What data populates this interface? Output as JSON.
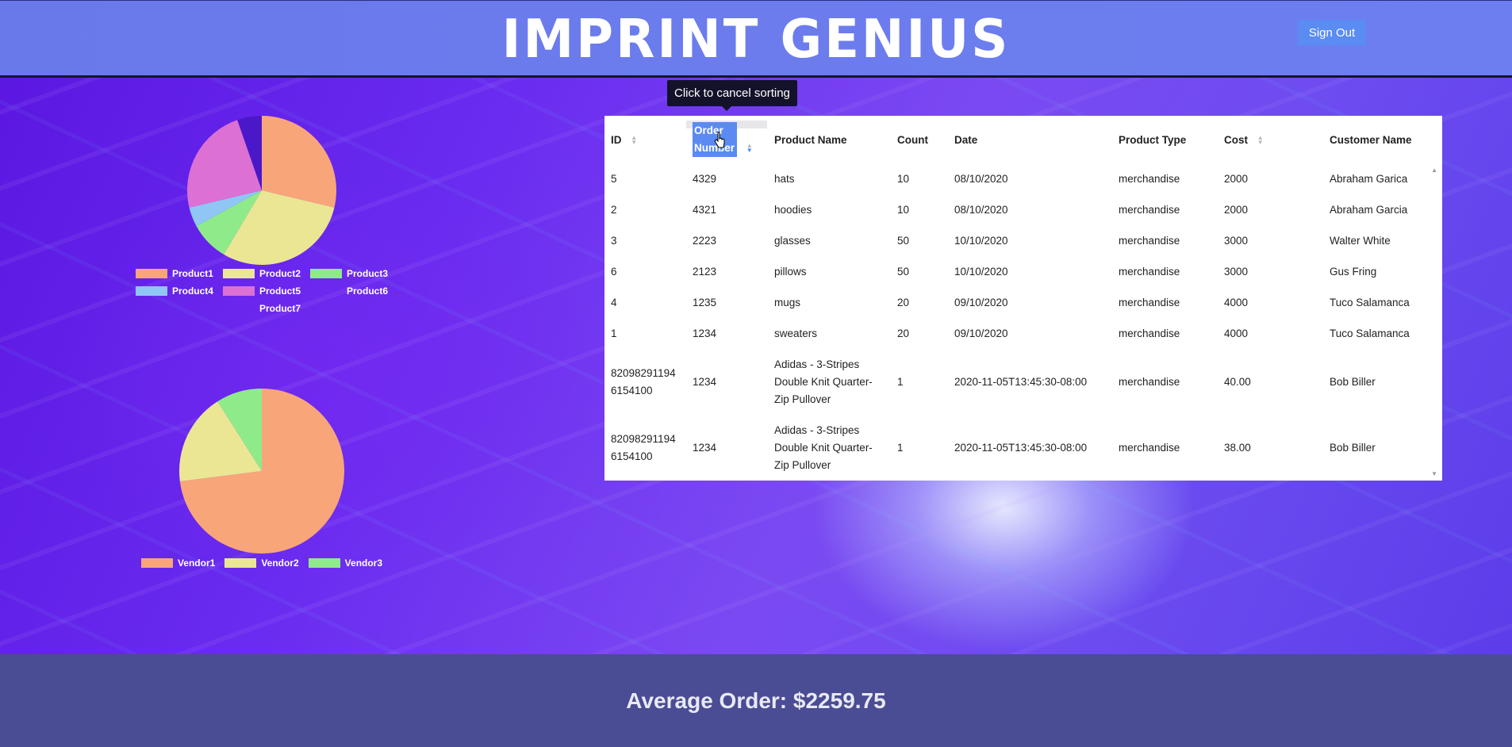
{
  "header": {
    "brand": "IMPRINT GENIUS",
    "sign_out": "Sign Out"
  },
  "tooltip": "Click to cancel sorting",
  "product_chart": {
    "type": "pie",
    "categories": [
      "Product1",
      "Product2",
      "Product3",
      "Product4",
      "Product5",
      "Product6",
      "Product7"
    ],
    "values": [
      27,
      28,
      8,
      4,
      22,
      0,
      5
    ],
    "colors": [
      "#f9a57a",
      "#ebe694",
      "#8feb8a",
      "#8fc6f5",
      "#dd70d3",
      "#5b27d6",
      "#4a18c8"
    ]
  },
  "vendor_chart": {
    "type": "pie",
    "categories": [
      "Vendor1",
      "Vendor2",
      "Vendor3"
    ],
    "values": [
      73,
      18,
      9
    ],
    "colors": [
      "#f9a57a",
      "#ebe694",
      "#8feb8a"
    ]
  },
  "table": {
    "headers": {
      "id": "ID",
      "order_number": "Order Number",
      "product_name": "Product Name",
      "count": "Count",
      "date": "Date",
      "product_type": "Product Type",
      "cost": "Cost",
      "customer_name": "Customer Name"
    },
    "rows": [
      {
        "id": "5",
        "order": "4329",
        "name": "hats",
        "count": "10",
        "date": "08/10/2020",
        "type": "merchandise",
        "cost": "2000",
        "customer": "Abraham Garica"
      },
      {
        "id": "2",
        "order": "4321",
        "name": "hoodies",
        "count": "10",
        "date": "08/10/2020",
        "type": "merchandise",
        "cost": "2000",
        "customer": "Abraham Garcia"
      },
      {
        "id": "3",
        "order": "2223",
        "name": "glasses",
        "count": "50",
        "date": "10/10/2020",
        "type": "merchandise",
        "cost": "3000",
        "customer": "Walter White"
      },
      {
        "id": "6",
        "order": "2123",
        "name": "pillows",
        "count": "50",
        "date": "10/10/2020",
        "type": "merchandise",
        "cost": "3000",
        "customer": "Gus Fring"
      },
      {
        "id": "4",
        "order": "1235",
        "name": "mugs",
        "count": "20",
        "date": "09/10/2020",
        "type": "merchandise",
        "cost": "4000",
        "customer": "Tuco Salamanca"
      },
      {
        "id": "1",
        "order": "1234",
        "name": "sweaters",
        "count": "20",
        "date": "09/10/2020",
        "type": "merchandise",
        "cost": "4000",
        "customer": "Tuco Salamanca"
      },
      {
        "id": "82098291194 6154100",
        "order": "1234",
        "name": "Adidas - 3-Stripes Double Knit Quarter-Zip Pullover",
        "count": "1",
        "date": "2020-11-05T13:45:30-08:00",
        "type": "merchandise",
        "cost": "40.00",
        "customer": "Bob Biller"
      },
      {
        "id": "82098291194 6154100",
        "order": "1234",
        "name": "Adidas - 3-Stripes Double Knit Quarter-Zip Pullover",
        "count": "1",
        "date": "2020-11-05T13:45:30-08:00",
        "type": "merchandise",
        "cost": "38.00",
        "customer": "Bob Biller"
      }
    ]
  },
  "footer": {
    "average_order": "Average Order: $2259.75"
  }
}
